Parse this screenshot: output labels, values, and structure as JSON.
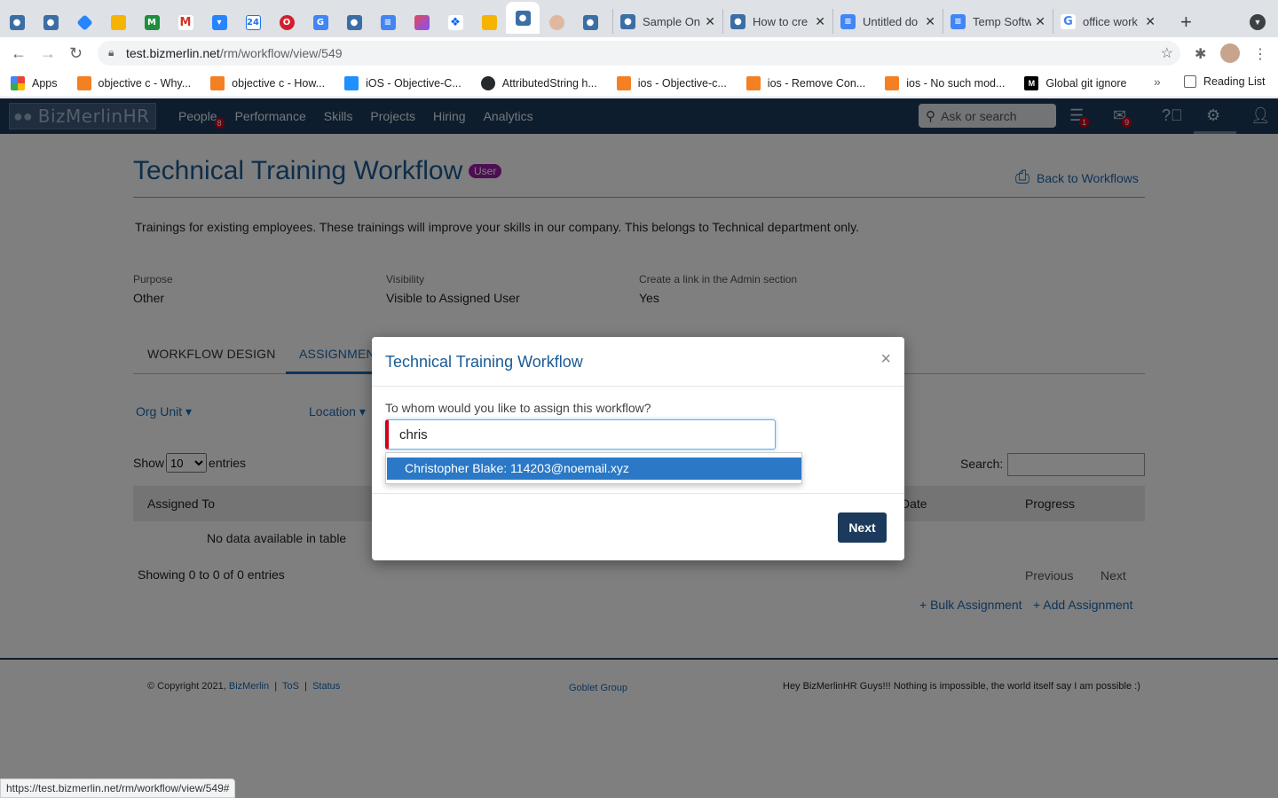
{
  "browser": {
    "tabs": [
      {
        "title": "Sample On",
        "favicon": "bizmerlin-icon"
      },
      {
        "title": "How to cre",
        "favicon": "bizmerlin-icon"
      },
      {
        "title": "Untitled do",
        "favicon": "google-docs-icon"
      },
      {
        "title": "Temp Softw",
        "favicon": "google-docs-icon"
      },
      {
        "title": "office work",
        "favicon": "google-icon"
      }
    ],
    "url_host": "test.bizmerlin.net",
    "url_path": "/rm/workflow/view/549",
    "bookmarks": [
      "Apps",
      "objective c - Why...",
      "objective c - How...",
      "iOS - Objective-C...",
      "AttributedString h...",
      "ios - Objective-c...",
      "ios - Remove Con...",
      "ios - No such mod...",
      "Global git ignore"
    ],
    "reading_list": "Reading List",
    "status_url": "https://test.bizmerlin.net/rm/workflow/view/549#"
  },
  "app": {
    "logo": "BizMerlinHR",
    "menu": [
      {
        "label": "People",
        "badge": "8"
      },
      {
        "label": "Performance",
        "badge": ""
      },
      {
        "label": "Skills",
        "badge": ""
      },
      {
        "label": "Projects",
        "badge": ""
      },
      {
        "label": "Hiring",
        "badge": ""
      },
      {
        "label": "Analytics",
        "badge": ""
      }
    ],
    "search_placeholder": "Ask or search",
    "tasks_badge": "1",
    "mail_badge": "9"
  },
  "page": {
    "title": "Technical Training Workflow",
    "role_badge": "User",
    "back_link": "Back to Workflows",
    "description": "Trainings for existing employees. These trainings will improve your skills in our company. This belongs to Technical department only.",
    "fields": [
      {
        "label": "Purpose",
        "value": "Other"
      },
      {
        "label": "Visibility",
        "value": "Visible to Assigned User"
      },
      {
        "label": "Create a link in the Admin section",
        "value": "Yes"
      }
    ],
    "tabs": [
      "WORKFLOW DESIGN",
      "ASSIGNMEN"
    ],
    "filters": [
      "Org Unit",
      "Location"
    ],
    "show_label": "Show",
    "entries_value": "10",
    "entries_label": "entries",
    "search_label": "Search:",
    "columns": [
      "Assigned To",
      "Date",
      "Progress"
    ],
    "no_data": "No data available in table",
    "showing": "Showing 0 to 0 of 0 entries",
    "pager": [
      "Previous",
      "Next"
    ],
    "bulk_assignment": "+ Bulk Assignment",
    "add_assignment": "+ Add Assignment"
  },
  "footer": {
    "copyright": "© Copyright 2021,",
    "links": [
      "BizMerlin",
      "ToS",
      "Status"
    ],
    "goblet": "Goblet Group",
    "tagline": "Hey BizMerlinHR Guys!!! Nothing is impossible, the world itself say I am possible :)"
  },
  "modal": {
    "title": "Technical Training Workflow",
    "prompt": "To whom would you like to assign this workflow?",
    "input_value": "chris",
    "suggestion": "Christopher Blake: 114203@noemail.xyz",
    "next_label": "Next"
  }
}
